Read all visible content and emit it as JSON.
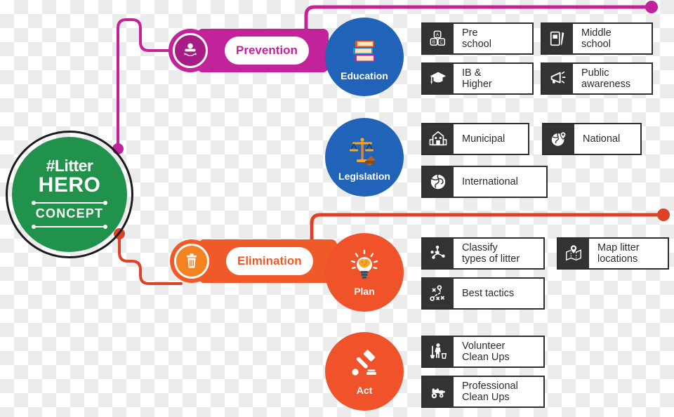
{
  "hero": {
    "line1": "#Litter",
    "line2": "HERO",
    "line3": "CONCEPT",
    "color": "#21924b"
  },
  "branches": [
    {
      "key": "prevention",
      "label": "Prevention",
      "color": "#c3239a",
      "icon": "recycle-person-icon"
    },
    {
      "key": "elimination",
      "label": "Elimination",
      "color": "#f05a28",
      "icon": "trash-can-icon"
    }
  ],
  "categories": [
    {
      "key": "education",
      "label": "Education",
      "color": "#2163b8",
      "icon": "books-icon",
      "items": [
        {
          "label": "Pre\nschool",
          "icon": "abc-blocks-icon"
        },
        {
          "label": "Middle\nschool",
          "icon": "notebook-pencil-icon"
        },
        {
          "label": "IB &\nHigher",
          "icon": "graduation-cap-icon"
        },
        {
          "label": "Public\nawareness",
          "icon": "megaphone-icon"
        }
      ]
    },
    {
      "key": "legislation",
      "label": "Legislation",
      "color": "#2163b8",
      "icon": "scales-gavel-icon",
      "items": [
        {
          "label": "Municipal",
          "icon": "city-hall-icon"
        },
        {
          "label": "National",
          "icon": "globe-pin-icon"
        },
        {
          "label": "International",
          "icon": "globe-icon"
        }
      ]
    },
    {
      "key": "plan",
      "label": "Plan",
      "color": "#f0522a",
      "icon": "lightbulb-brain-icon",
      "items": [
        {
          "label": "Classify\ntypes of litter",
          "icon": "network-nodes-icon"
        },
        {
          "label": "Map litter\nlocations",
          "icon": "map-pin-icon"
        },
        {
          "label": "Best tactics",
          "icon": "strategy-icon"
        }
      ]
    },
    {
      "key": "act",
      "label": "Act",
      "color": "#f0522a",
      "icon": "gavel-icon",
      "items": [
        {
          "label": "Volunteer\nClean Ups",
          "icon": "person-sweeping-icon"
        },
        {
          "label": "Professional\nClean Ups",
          "icon": "street-sweeper-icon"
        }
      ]
    }
  ],
  "connectors": {
    "prevention_color": "#c3239a",
    "elimination_color": "#dd4226"
  }
}
